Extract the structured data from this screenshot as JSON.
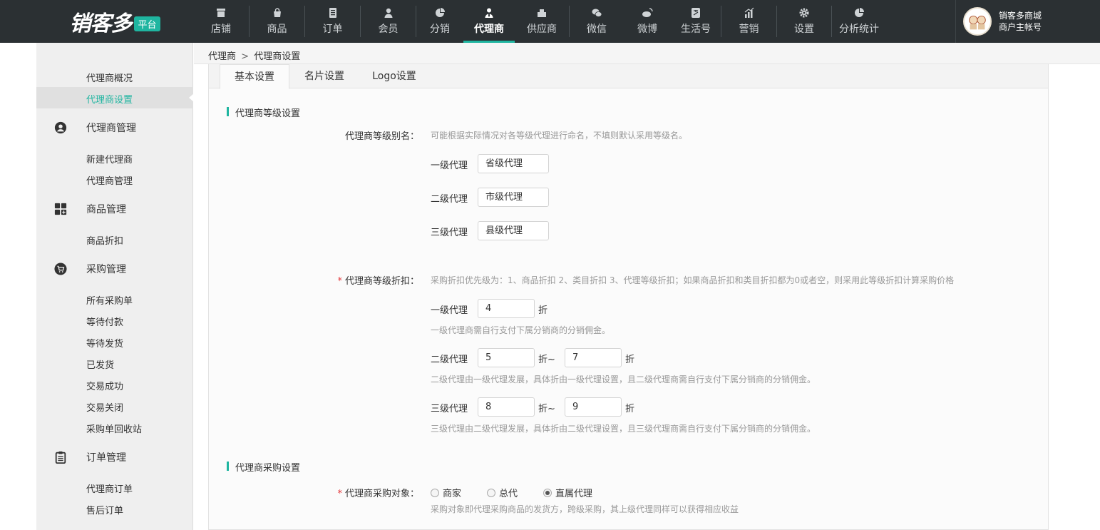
{
  "logo": {
    "text": "销客多",
    "badge": "平台"
  },
  "nav": [
    {
      "label": "店铺",
      "icon": "store-icon"
    },
    {
      "label": "商品",
      "icon": "bag-icon"
    },
    {
      "label": "订单",
      "icon": "document-icon"
    },
    {
      "label": "会员",
      "icon": "person-icon"
    },
    {
      "label": "分销",
      "icon": "pie-icon"
    },
    {
      "label": "代理商",
      "icon": "agent-icon",
      "active": true
    },
    {
      "label": "供应商",
      "icon": "supplier-icon"
    },
    {
      "label": "微信",
      "icon": "wechat-icon"
    },
    {
      "label": "微博",
      "icon": "weibo-icon"
    },
    {
      "label": "生活号",
      "icon": "alipay-icon"
    },
    {
      "label": "营销",
      "icon": "chart-icon"
    },
    {
      "label": "设置",
      "icon": "gear-icon"
    },
    {
      "label": "分析统计",
      "icon": "pie-icon"
    }
  ],
  "user": {
    "line1": "销客多商城",
    "line2": "商户主帐号"
  },
  "sidebar": {
    "top_items": [
      "代理商概况",
      "代理商设置"
    ],
    "groups": [
      {
        "title": "代理商管理",
        "icon": "user-circle-icon",
        "items": [
          "新建代理商",
          "代理商管理"
        ]
      },
      {
        "title": "商品管理",
        "icon": "grid-icon",
        "items": [
          "商品折扣"
        ]
      },
      {
        "title": "采购管理",
        "icon": "cart-icon",
        "items": [
          "所有采购单",
          "等待付款",
          "等待发货",
          "已发货",
          "交易成功",
          "交易关闭",
          "采购单回收站"
        ]
      },
      {
        "title": "订单管理",
        "icon": "clipboard-icon",
        "items": [
          "代理商订单",
          "售后订单"
        ]
      }
    ]
  },
  "breadcrumb": {
    "root": "代理商",
    "sep": ">",
    "current": "代理商设置"
  },
  "tabs": [
    "基本设置",
    "名片设置",
    "Logo设置"
  ],
  "level_section": {
    "title": "代理商等级设置",
    "alias_label": "代理商等级别名：",
    "alias_hint": "可能根据实际情况对各等级代理进行命名，不填则默认采用等级名。",
    "aliases": [
      {
        "label": "一级代理",
        "value": "省级代理"
      },
      {
        "label": "二级代理",
        "value": "市级代理"
      },
      {
        "label": "三级代理",
        "value": "县级代理"
      }
    ],
    "discount_required": "*",
    "discount_label": "代理商等级折扣：",
    "discount_hint": "采购折扣优先级为：1、商品折扣 2、类目折扣 3、代理等级折扣；如果商品折扣和类目折扣都为0或者空，则采用此等级折扣计算采购价格",
    "unit": "折",
    "range_unit": "折~",
    "levels": [
      {
        "label": "一级代理",
        "value": "4",
        "hint": "一级代理商需自行支付下属分销商的分销佣金。"
      },
      {
        "label": "二级代理",
        "min": "5",
        "max": "7",
        "hint": "二级代理由一级代理发展，具体折由一级代理设置，且二级代理商需自行支付下属分销商的分销佣金。"
      },
      {
        "label": "三级代理",
        "min": "8",
        "max": "9",
        "hint": "三级代理由二级代理发展，具体折由二级代理设置，且三级代理商需自行支付下属分销商的分销佣金。"
      }
    ]
  },
  "purchase_section": {
    "title": "代理商采购设置",
    "required": "*",
    "label": "代理商采购对象：",
    "options": [
      "商家",
      "总代",
      "直属代理"
    ],
    "selected": "直属代理",
    "hint": "采购对象即代理采购商品的发货方，跨级采购，其上级代理同样可以获得相应收益"
  },
  "colors": {
    "accent": "#1fb5a0",
    "topbar": "#2b3033",
    "required": "#e4393c"
  }
}
